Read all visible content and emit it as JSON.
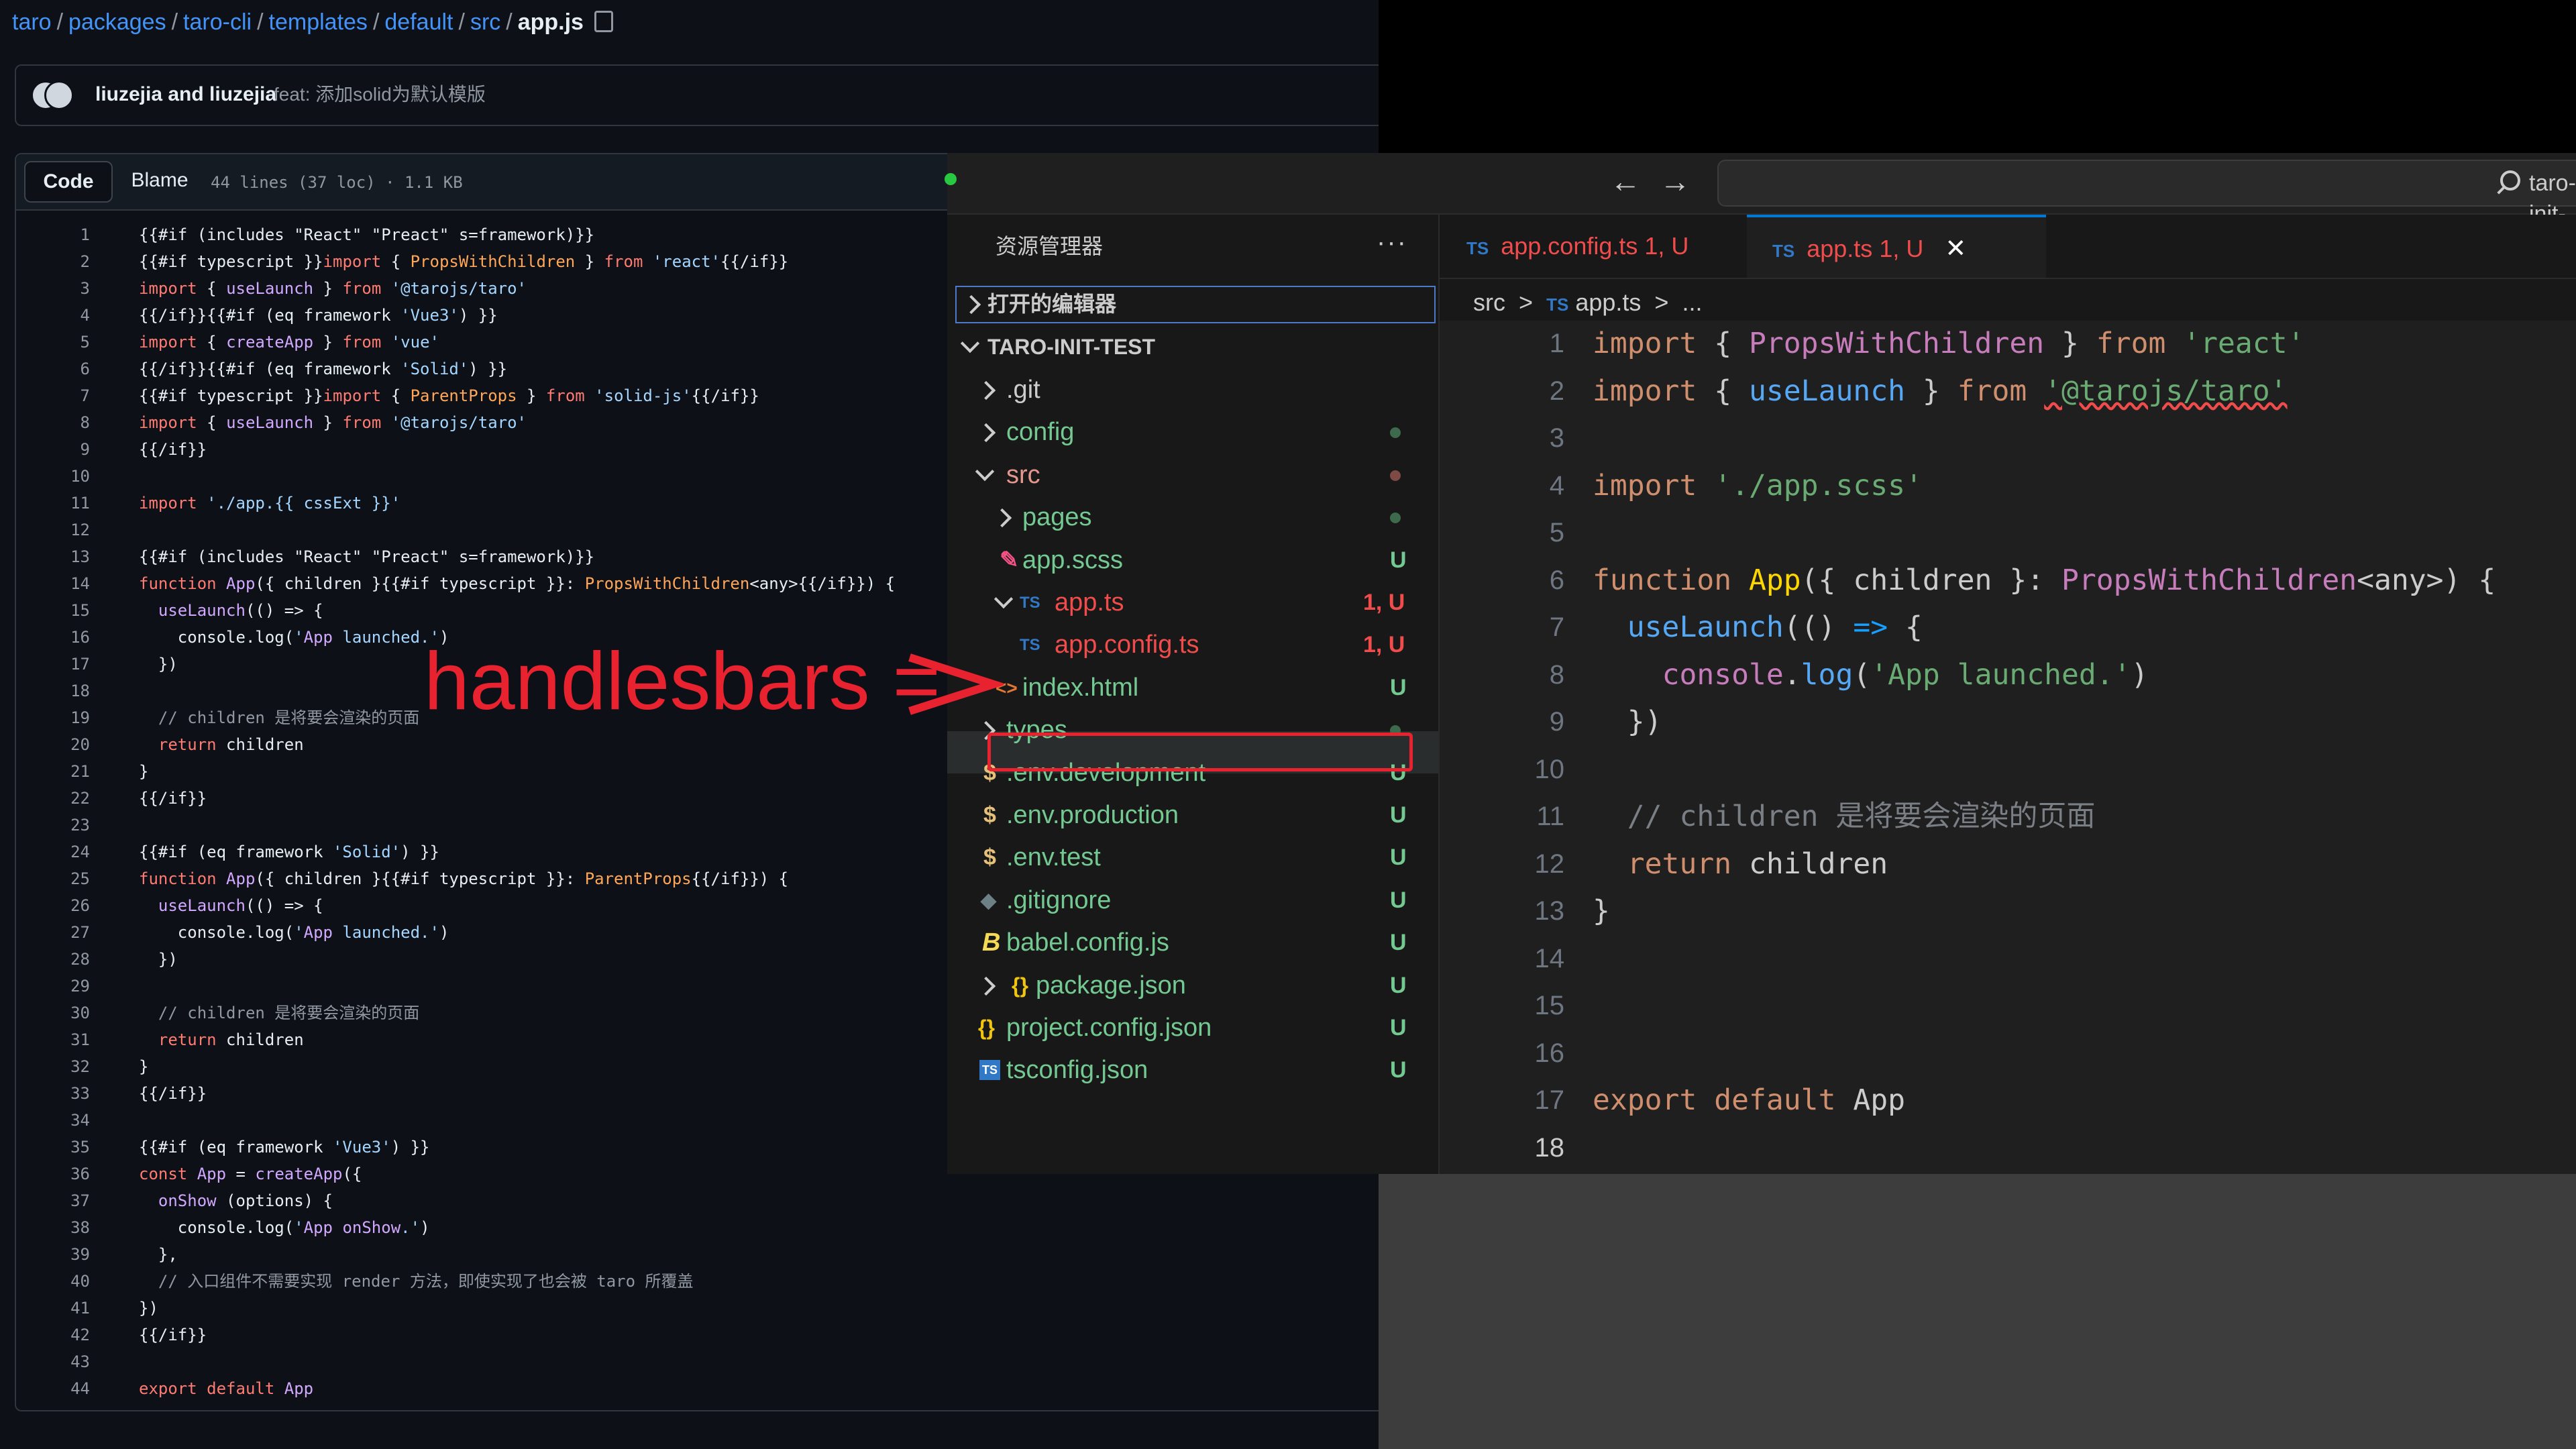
{
  "github": {
    "breadcrumb": [
      "taro",
      "packages",
      "taro-cli",
      "templates",
      "default",
      "src"
    ],
    "current_file": "app.js",
    "commit": {
      "authors": "liuzejia and liuzejia",
      "message": "feat: 添加solid为默认模版"
    },
    "tabs": {
      "code": "Code",
      "blame": "Blame"
    },
    "file_info": "44 lines (37 loc) · 1.1 KB",
    "code_lines": [
      "{{#if (includes \"React\" \"Preact\" s=framework)}}",
      "{{#if typescript }}import { PropsWithChildren } from 'react'{{/if}}",
      "import { useLaunch } from '@tarojs/taro'",
      "{{/if}}{{#if (eq framework 'Vue3') }}",
      "import { createApp } from 'vue'",
      "{{/if}}{{#if (eq framework 'Solid') }}",
      "{{#if typescript }}import { ParentProps } from 'solid-js'{{/if}}",
      "import { useLaunch } from '@tarojs/taro'",
      "{{/if}}",
      "",
      "import './app.{{ cssExt }}'",
      "",
      "{{#if (includes \"React\" \"Preact\" s=framework)}}",
      "function App({ children }{{#if typescript }}: PropsWithChildren<any>{{/if}}) {",
      "  useLaunch(() => {",
      "    console.log('App launched.')",
      "  })",
      "",
      "  // children 是将要会渲染的页面",
      "  return children",
      "}",
      "{{/if}}",
      "",
      "{{#if (eq framework 'Solid') }}",
      "function App({ children }{{#if typescript }}: ParentProps{{/if}}) {",
      "  useLaunch(() => {",
      "    console.log('App launched.')",
      "  })",
      "",
      "  // children 是将要会渲染的页面",
      "  return children",
      "}",
      "{{/if}}",
      "",
      "{{#if (eq framework 'Vue3') }}",
      "const App = createApp({",
      "  onShow (options) {",
      "    console.log('App onShow.')",
      "  },",
      "  // 入口组件不需要实现 render 方法，即使实现了也会被 taro 所覆盖",
      "})",
      "{{/if}}",
      "",
      "export default App"
    ]
  },
  "vscode": {
    "nav_back": "←",
    "nav_forward": "→",
    "search_text": "taro-init-test",
    "explorer_title": "资源管理器",
    "explorer_more": "···",
    "open_editors": "打开的编辑器",
    "project": "TARO-INIT-TEST",
    "tree": [
      {
        "name": ".git",
        "status": ""
      },
      {
        "name": "config",
        "status": ""
      },
      {
        "name": "src",
        "status": ""
      },
      {
        "name": "pages",
        "status": ""
      },
      {
        "name": "app.scss",
        "status": "U"
      },
      {
        "name": "app.ts",
        "status": "1, U",
        "icon": "TS"
      },
      {
        "name": "app.config.ts",
        "status": "1, U",
        "icon": "TS"
      },
      {
        "name": "index.html",
        "status": "U"
      },
      {
        "name": "types",
        "status": ""
      },
      {
        "name": ".env.development",
        "status": "U",
        "icon": "$"
      },
      {
        "name": ".env.production",
        "status": "U",
        "icon": "$"
      },
      {
        "name": ".env.test",
        "status": "U",
        "icon": "$"
      },
      {
        "name": ".gitignore",
        "status": "U"
      },
      {
        "name": "babel.config.js",
        "status": "U"
      },
      {
        "name": "package.json",
        "status": "U",
        "icon": "{}"
      },
      {
        "name": "project.config.json",
        "status": "U",
        "icon": "{}"
      },
      {
        "name": "tsconfig.json",
        "status": "U",
        "icon": "TS"
      }
    ],
    "tabs": [
      {
        "icon": "TS",
        "name": "app.config.ts",
        "status": "1, U"
      },
      {
        "icon": "TS",
        "name": "app.ts",
        "status": "1, U",
        "close": "✕"
      }
    ],
    "breadcrumb": {
      "folder": "src",
      "sep": ">",
      "icon": "TS",
      "file": "app.ts",
      "more": "..."
    },
    "line_numbers": [
      "1",
      "2",
      "3",
      "4",
      "5",
      "6",
      "7",
      "8",
      "9",
      "10",
      "11",
      "12",
      "13",
      "14",
      "15",
      "16",
      "17",
      "18"
    ],
    "code_lines": [
      "import { PropsWithChildren } from 'react'",
      "import { useLaunch } from '@tarojs/taro'",
      "",
      "import './app.scss'",
      "",
      "function App({ children }: PropsWithChildren<any>) {",
      "  useLaunch(() => {",
      "    console.log('App launched.')",
      "  })",
      "",
      "  // children 是将要会渲染的页面",
      "  return children",
      "}",
      "",
      "",
      "",
      "export default App",
      ""
    ]
  },
  "annotation": "handlesbars =",
  "colors": {
    "annotation_red": "#e8222e",
    "github_link": "#4493f8",
    "vscode_accent": "#0078d4",
    "untracked_green": "#73c991"
  }
}
